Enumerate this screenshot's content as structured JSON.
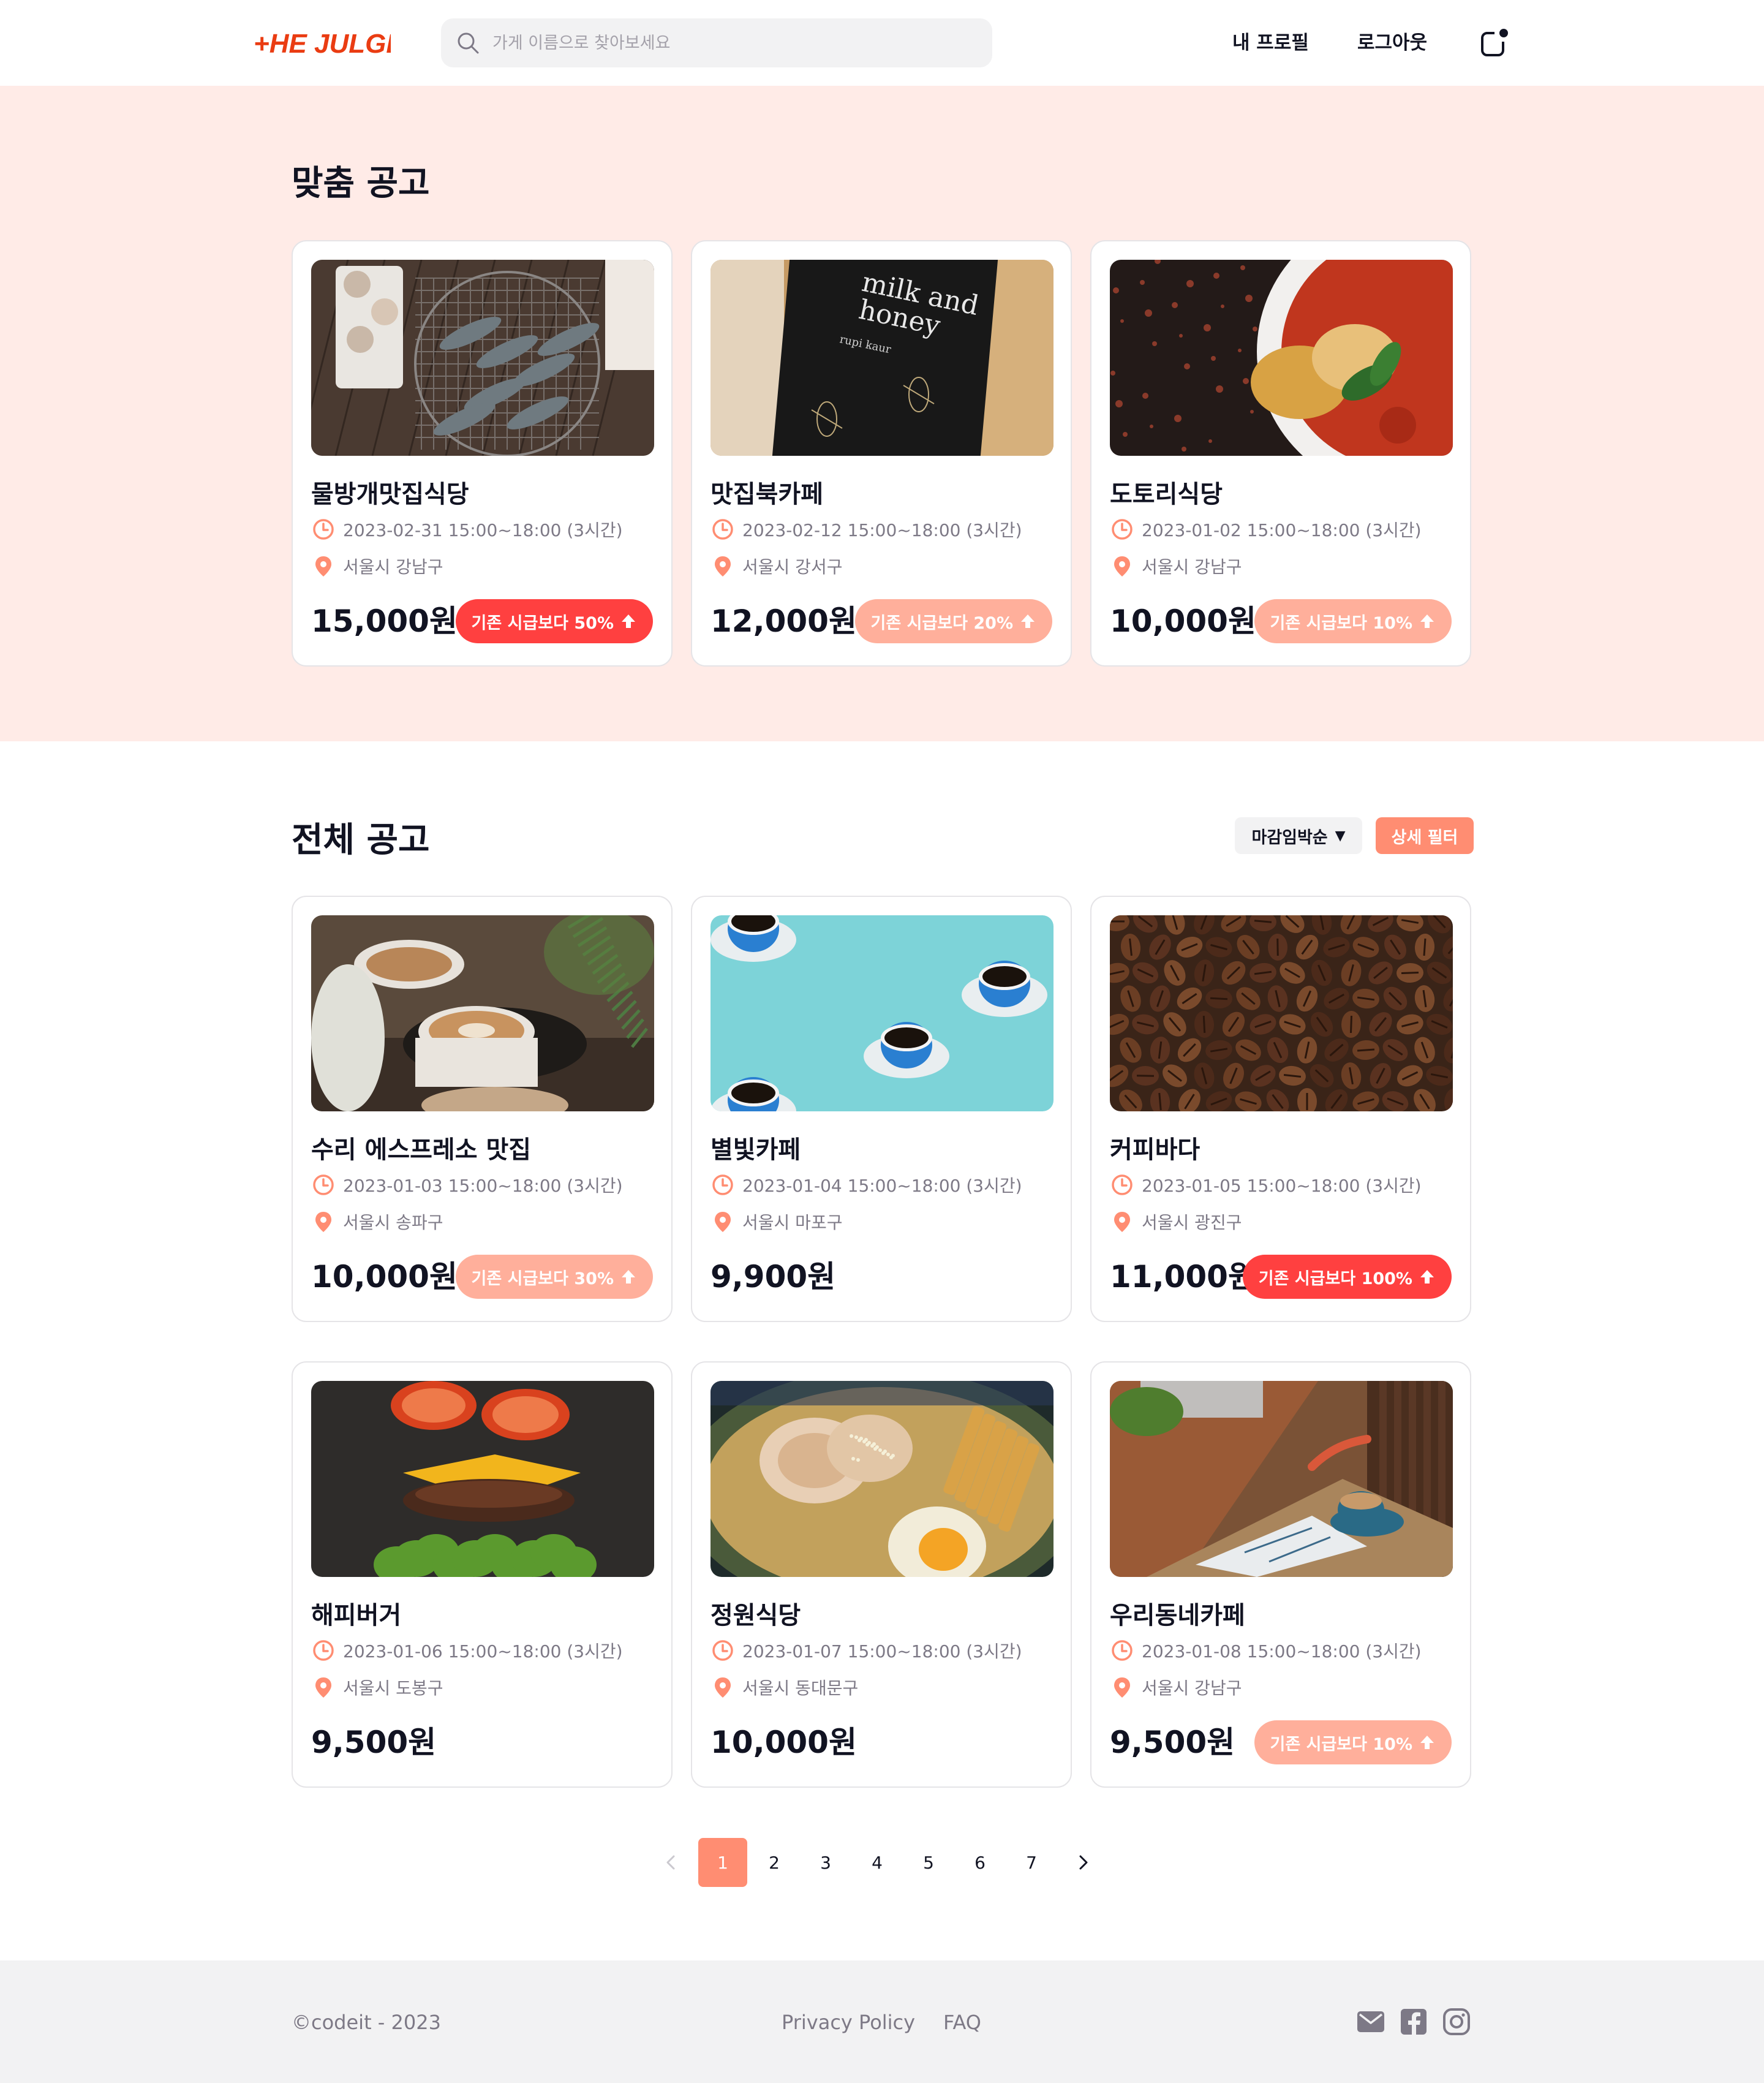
{
  "header": {
    "logo_text": "+HE JULGE",
    "search_placeholder": "가게 이름으로 찾아보세요",
    "profile_label": "내 프로필",
    "logout_label": "로그아웃",
    "notification_icon": "notification-icon"
  },
  "custom": {
    "title": "맞춤 공고",
    "cards": [
      {
        "name": "물방개맛집식당",
        "time": "2023-02-31 15:00~18:00 (3시간)",
        "location": "서울시 강남구",
        "price": "15,000원",
        "badge": "기존 시급보다 50%",
        "badge_level": "strong",
        "image": "grilled-shrimp"
      },
      {
        "name": "맛집북카페",
        "time": "2023-02-12 15:00~18:00 (3시간)",
        "location": "서울시 강서구",
        "price": "12,000원",
        "badge": "기존 시급보다 20%",
        "badge_level": "light",
        "image": "milk-and-honey-book"
      },
      {
        "name": "도토리식당",
        "time": "2023-01-02 15:00~18:00 (3시간)",
        "location": "서울시 강남구",
        "price": "10,000원",
        "badge": "기존 시급보다 10%",
        "badge_level": "light",
        "image": "curry-bowl"
      }
    ]
  },
  "all": {
    "title": "전체 공고",
    "sort_label": "마감임박순",
    "filter_label": "상세 필터",
    "cards": [
      {
        "name": "수리 에스프레소 맛집",
        "time": "2023-01-03 15:00~18:00 (3시간)",
        "location": "서울시 송파구",
        "price": "10,000원",
        "badge": "기존 시급보다 30%",
        "badge_level": "light",
        "image": "latte-cups"
      },
      {
        "name": "별빛카페",
        "time": "2023-01-04 15:00~18:00 (3시간)",
        "location": "서울시 마포구",
        "price": "9,900원",
        "badge": "",
        "badge_level": "",
        "image": "blue-coffee-cups"
      },
      {
        "name": "커피바다",
        "time": "2023-01-05 15:00~18:00 (3시간)",
        "location": "서울시 광진구",
        "price": "11,000원",
        "badge": "기존 시급보다 100%",
        "badge_level": "strong",
        "image": "coffee-beans"
      },
      {
        "name": "해피버거",
        "time": "2023-01-06 15:00~18:00 (3시간)",
        "location": "서울시 도봉구",
        "price": "9,500원",
        "badge": "",
        "badge_level": "",
        "image": "burger"
      },
      {
        "name": "정원식당",
        "time": "2023-01-07 15:00~18:00 (3시간)",
        "location": "서울시 동대문구",
        "price": "10,000원",
        "badge": "",
        "badge_level": "",
        "image": "ramen"
      },
      {
        "name": "우리동네카페",
        "time": "2023-01-08 15:00~18:00 (3시간)",
        "location": "서울시 강남구",
        "price": "9,500원",
        "badge": "기존 시급보다 10%",
        "badge_level": "light",
        "image": "cafe-table"
      }
    ]
  },
  "pagination": {
    "pages": [
      "1",
      "2",
      "3",
      "4",
      "5",
      "6",
      "7"
    ],
    "current": "1"
  },
  "footer": {
    "copyright": "©codeit - 2023",
    "privacy": "Privacy Policy",
    "faq": "FAQ",
    "social_icons": [
      "mail-icon",
      "facebook-icon",
      "instagram-icon"
    ]
  },
  "colors": {
    "brand": "#ea3c12",
    "custom_bg": "#ffebe7",
    "badge_strong": "#ff4040",
    "badge_light": "#ffaf9b",
    "accent": "#ff8d72"
  }
}
